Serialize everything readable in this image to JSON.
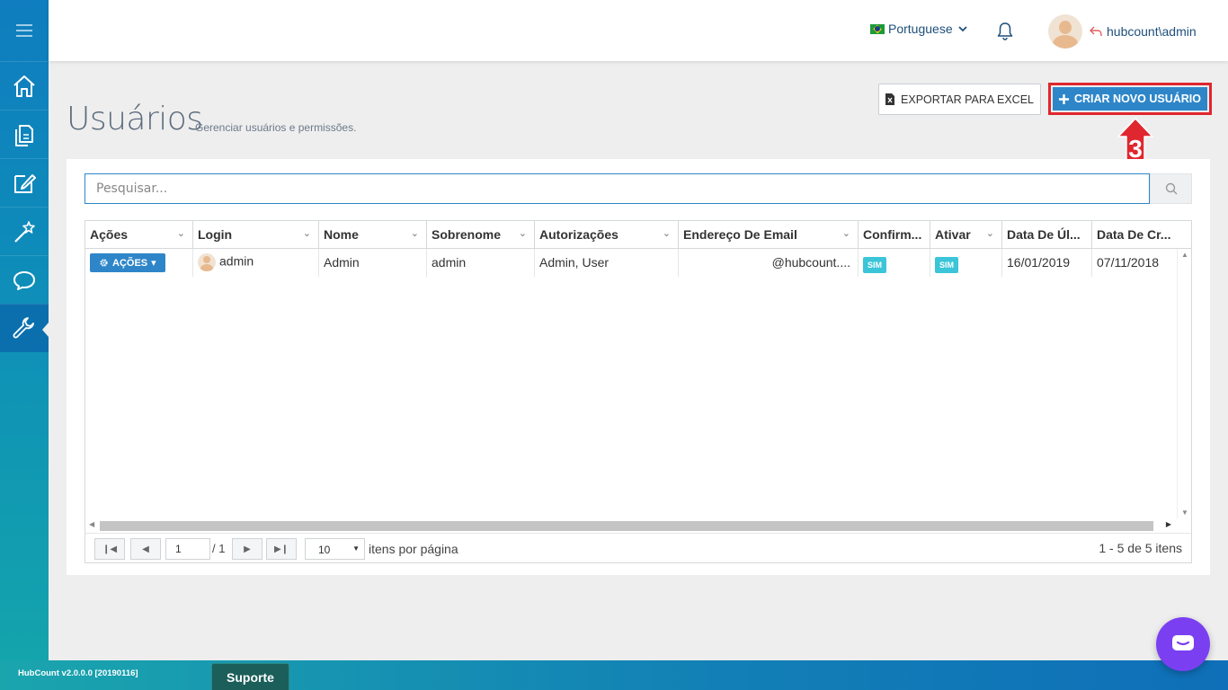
{
  "header": {
    "language": "Portuguese",
    "username": "hubcount\\admin"
  },
  "page": {
    "title": "Usuários",
    "subtitle": "Gerenciar usuários e permissões.",
    "export_label": "EXPORTAR PARA EXCEL",
    "create_label": "CRIAR NOVO USUÁRIO",
    "callout_number": "3"
  },
  "search": {
    "placeholder": "Pesquisar..."
  },
  "table": {
    "columns": [
      "Ações",
      "Login",
      "Nome",
      "Sobrenome",
      "Autorizações",
      "Endereço De Email",
      "Confirm...",
      "Ativar",
      "Data De Úl...",
      "Data De Cr..."
    ],
    "rows": [
      {
        "actions_label": "AÇÕES",
        "login": "admin",
        "nome": "Admin",
        "sobrenome": "admin",
        "autorizacoes": "Admin, User",
        "email": "@hubcount....",
        "confirmado": "SIM",
        "ativo": "SIM",
        "ultimo_login": "16/01/2019",
        "criacao": "07/11/2018"
      }
    ]
  },
  "pager": {
    "current_page": "1",
    "of_pages": "/ 1",
    "page_size": "10",
    "per_page_label": "itens por página",
    "info": "1 - 5 de 5 itens"
  },
  "footer": {
    "version": "HubCount v2.0.0.0 [20190116]",
    "support_label": "Suporte"
  },
  "colors": {
    "primary": "#2e86c9",
    "highlight": "#e0262e",
    "badge": "#3cc5d8",
    "chat": "#7b3ff2"
  }
}
